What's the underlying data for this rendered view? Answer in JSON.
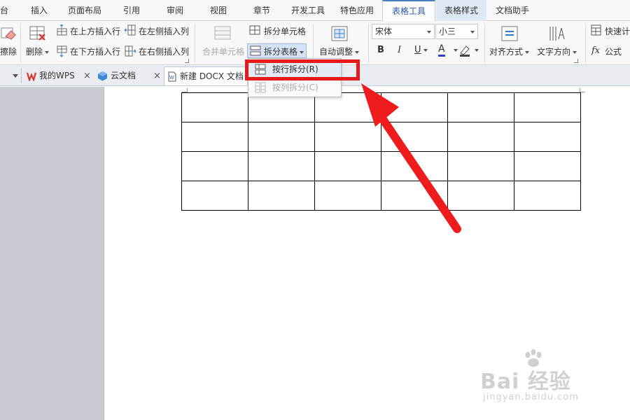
{
  "menu": {
    "tabs": [
      "台",
      "插入",
      "页面布局",
      "引用",
      "审阅",
      "视图",
      "章节",
      "开发工具",
      "特色应用",
      "表格工具",
      "表格样式",
      "文档助手"
    ]
  },
  "ribbon": {
    "erase_label": "擦除",
    "delete_label": "删除",
    "insert_above_label": "在上方插入行",
    "insert_below_label": "在下方插入行",
    "insert_left_label": "在左侧插入列",
    "insert_right_label": "在右侧插入列",
    "merge_cells_label": "合并单元格",
    "split_cells_label": "拆分单元格",
    "split_table_label": "拆分表格",
    "autofit_label": "自动调整",
    "font_name": "宋体",
    "font_size": "小三",
    "bold_label": "B",
    "italic_label": "I",
    "underline_label": "U",
    "font_color_label": "A",
    "align_label": "对齐方式",
    "text_direction_label": "文字方向",
    "quick_calc_label": "快速计",
    "formula_label": "公式",
    "fx_label": "fx"
  },
  "doc_tabs": {
    "items": [
      {
        "label": "我的WPS"
      },
      {
        "label": "云文档"
      },
      {
        "label": "新建 DOCX 文档"
      }
    ]
  },
  "dropdown": {
    "split_by_row": "按行拆分(R)",
    "split_by_col": "按列拆分(C)"
  },
  "table": {
    "rows": 4,
    "cols": 6
  },
  "watermark": {
    "brand": "Bai 经验",
    "url": "jingyan.baidu.com"
  },
  "colors": {
    "highlight": "#e8191a",
    "arrow": "#ee1c1c",
    "accent": "#2b5aa3"
  },
  "icons": [
    "eraser-icon",
    "delete-table-icon",
    "insert-row-above-icon",
    "insert-row-below-icon",
    "insert-col-left-icon",
    "insert-col-right-icon",
    "merge-cells-icon",
    "split-cells-icon",
    "split-table-icon",
    "autofit-icon",
    "align-icon",
    "text-direction-icon",
    "quick-calc-icon",
    "formula-icon",
    "red-arrow-icon",
    "baidu-paw-icon"
  ]
}
